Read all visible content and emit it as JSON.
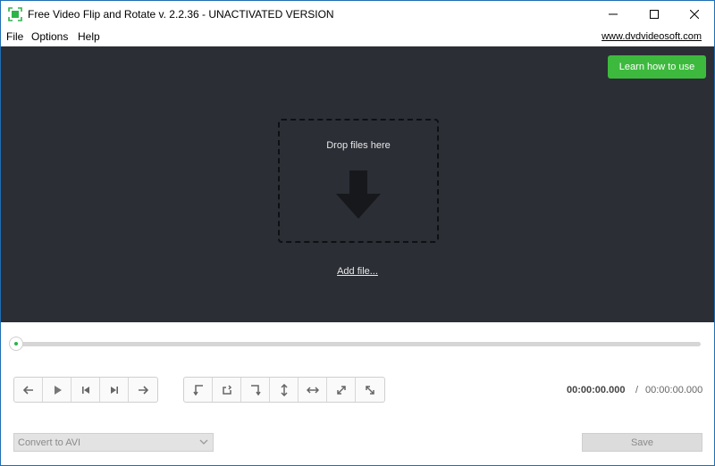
{
  "window": {
    "title": "Free Video Flip and Rotate v. 2.2.36 - UNACTIVATED VERSION",
    "icon": "flip-rotate-app-icon",
    "controls": [
      "minimize-icon",
      "maximize-icon",
      "close-icon"
    ]
  },
  "menu": {
    "items": [
      "File",
      "Options",
      "Help"
    ],
    "site_link": "www.dvdvideosoft.com"
  },
  "drop_area": {
    "learn_button": "Learn how to use",
    "drop_text": "Drop files here",
    "add_file": "Add file...",
    "icon": "down-arrow-icon"
  },
  "timeline": {
    "position_fraction": 0.0
  },
  "playback_buttons": [
    "arrow-left-icon",
    "play-icon",
    "skip-start-icon",
    "skip-end-icon",
    "arrow-right-icon"
  ],
  "rotate_buttons": [
    "rotate-left-icon",
    "rotate-right-icon",
    "rotate-180-icon",
    "flip-vertical-icon",
    "flip-horizontal-icon",
    "flip-diagonal-icon",
    "flip-antidiagonal-icon"
  ],
  "time": {
    "current": "00:00:00.000",
    "separator": "/",
    "total": "00:00:00.000"
  },
  "footer": {
    "format_value": "Convert to AVI",
    "save_label": "Save"
  },
  "colors": {
    "accent_green": "#3dba3d",
    "dark_bg": "#2b2e35",
    "handle_dot": "#2cb34a"
  }
}
